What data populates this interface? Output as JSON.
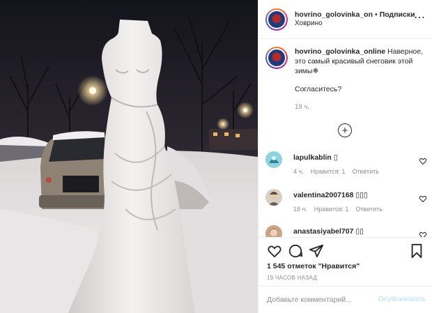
{
  "header": {
    "username": "hovrino_golovinka_on",
    "separator": "•",
    "follow_label": "Подписки",
    "location": "Ховрино",
    "more_icon": "more-horizontal-icon"
  },
  "caption": {
    "username": "hovrino_golovinka_online",
    "text": "Наверное, это самый красивый снеговик этой зимы❄",
    "question": "Согласитесь?",
    "time": "19 ч."
  },
  "load_more_icon": "plus-circle-icon",
  "comments": [
    {
      "username": "lapulkablin",
      "text": "▯",
      "time": "4 ч.",
      "likes_label": "Нравится: 1",
      "reply_label": "Ответить"
    },
    {
      "username": "valentina2007168",
      "text": "▯▯▯",
      "time": "18 ч.",
      "likes_label": "Нравится: 1",
      "reply_label": "Ответить"
    },
    {
      "username": "anastasiyabel707",
      "text": "▯▯",
      "time": "",
      "likes_label": "",
      "reply_label": ""
    }
  ],
  "actions": {
    "like_icon": "heart-icon",
    "comment_icon": "comment-icon",
    "share_icon": "send-icon",
    "save_icon": "bookmark-icon"
  },
  "likes_text": "1 545 отметок \"Нравится\"",
  "time_ago": "19 ЧАСОВ НАЗАД",
  "add_comment": {
    "placeholder": "Добавьте комментарий...",
    "publish_label": "Опубликовать"
  },
  "colors": {
    "text": "#262626",
    "secondary": "#8e8e8e",
    "border": "#efefef",
    "publish_disabled": "#b2dffc"
  }
}
